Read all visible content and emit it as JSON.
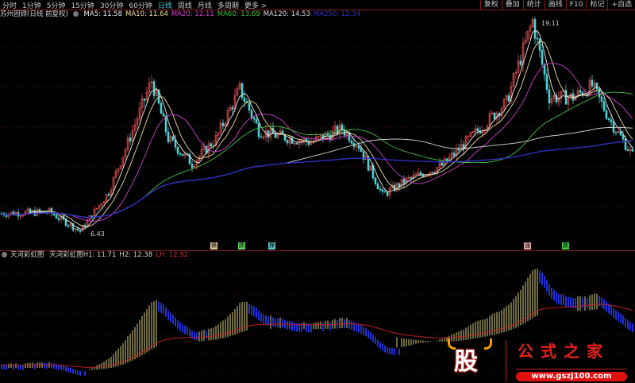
{
  "toolbar": {
    "periods": [
      "分时",
      "1分钟",
      "5分钟",
      "15分钟",
      "30分钟",
      "60分钟",
      "日线",
      "周线",
      "月线",
      "多周期",
      "更多 >"
    ],
    "active": "日线",
    "right_buttons": [
      "复权",
      "叠加",
      "统计",
      "画线",
      "F10",
      "标记",
      "+自选"
    ]
  },
  "ma_legend": {
    "title": "苏州固锝(日线 前复权)",
    "items": [
      {
        "label": "MA5: 11.58",
        "color": "#e8e8e8"
      },
      {
        "label": "MA10: 11.64",
        "color": "#e8e0a0"
      },
      {
        "label": "MA20: 12.11",
        "color": "#d040d0"
      },
      {
        "label": "MA60: 13.69",
        "color": "#40c040"
      },
      {
        "label": "MA120: 14.53",
        "color": "#d8d8d8"
      },
      {
        "label": "MA250: 12.34",
        "color": "#3030c0"
      }
    ]
  },
  "indicator_legend": {
    "title": "天河彩虹图",
    "items": [
      {
        "label": "天河彩虹图H1: 11.71",
        "color": "#d0d0d0"
      },
      {
        "label": "H2: 12.38",
        "color": "#d0d0d0"
      },
      {
        "label": "LH: 12.92",
        "color": "#c03030"
      }
    ]
  },
  "signals": [
    {
      "label": "横",
      "color": "#e0c8a0"
    },
    {
      "label": "跌",
      "color": "#60d060"
    },
    {
      "label": "撑",
      "color": "#60c8c8"
    },
    {
      "label": "涨",
      "color": "#e0a0a0"
    },
    {
      "label": "跌",
      "color": "#40c040"
    }
  ],
  "watermark": {
    "badge": "股",
    "title": "公式之家",
    "url": "www.gszj100.com"
  },
  "chart_data": {
    "type": "candlestick",
    "series_name": "苏州固锝 日线",
    "annotations": [
      {
        "label": "19.11",
        "type": "high"
      },
      {
        "label": "6.43",
        "type": "low"
      }
    ],
    "price_range": [
      6.0,
      19.5
    ],
    "price_keyframes": [
      [
        0,
        7.5
      ],
      [
        20,
        7.6
      ],
      [
        33,
        6.43
      ],
      [
        45,
        8.8
      ],
      [
        55,
        12.5
      ],
      [
        63,
        15.5
      ],
      [
        70,
        12
      ],
      [
        80,
        10.5
      ],
      [
        90,
        12
      ],
      [
        100,
        15
      ],
      [
        108,
        12.5
      ],
      [
        115,
        12.2
      ],
      [
        130,
        11.8
      ],
      [
        143,
        12.6
      ],
      [
        150,
        11.6
      ],
      [
        160,
        8.6
      ],
      [
        170,
        9.5
      ],
      [
        185,
        10.4
      ],
      [
        200,
        12.5
      ],
      [
        212,
        14.2
      ],
      [
        223,
        19.11
      ],
      [
        230,
        14.5
      ],
      [
        240,
        14.5
      ],
      [
        248,
        15.2
      ],
      [
        256,
        13
      ],
      [
        265,
        11
      ]
    ],
    "ma_periods": [
      5,
      10,
      20,
      60,
      120,
      250
    ]
  }
}
